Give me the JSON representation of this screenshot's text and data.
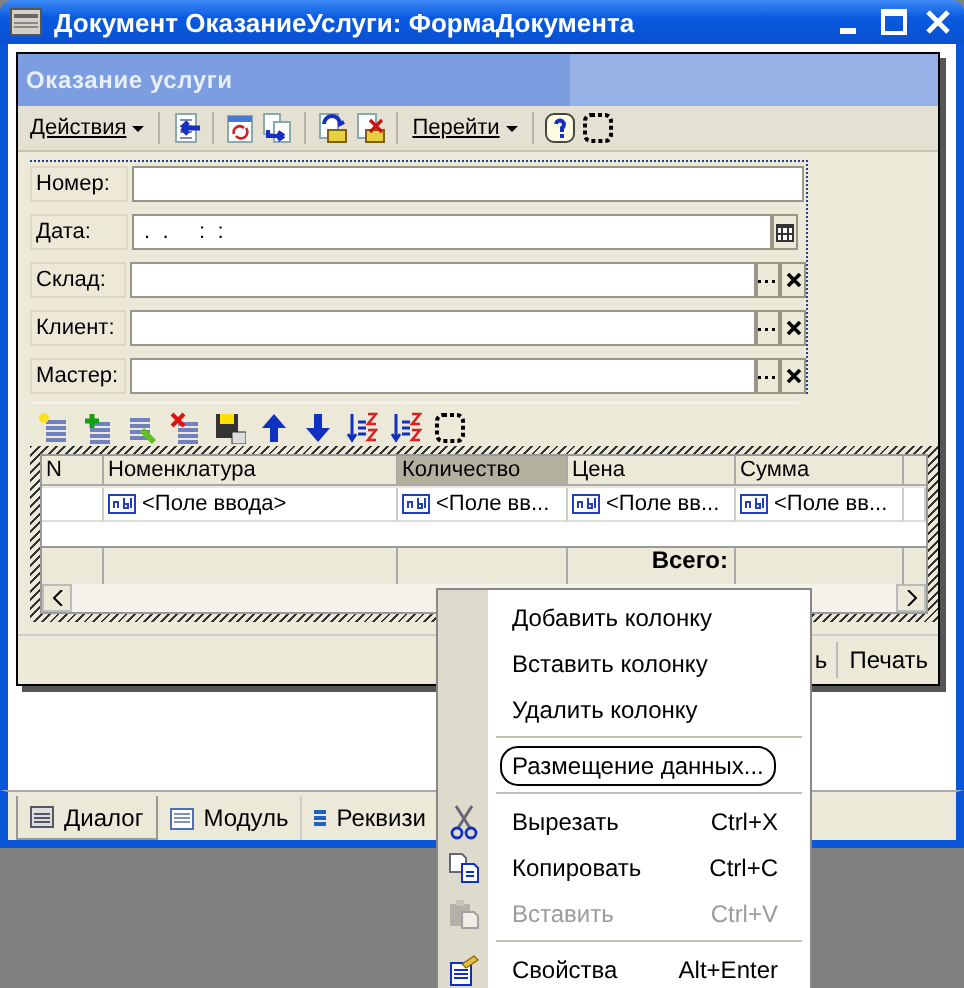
{
  "window": {
    "title": "Документ ОказаниеУслуги: ФормаДокумента"
  },
  "form": {
    "title": "Оказание услуги",
    "toolbar_menus": [
      "Действия",
      "Перейти"
    ],
    "fields": [
      {
        "kind": "text",
        "label": "Номер:"
      },
      {
        "kind": "date",
        "label": "Дата:",
        "value": " .  .     :  :"
      },
      {
        "kind": "ref",
        "label": "Склад:"
      },
      {
        "kind": "ref",
        "label": "Клиент:"
      },
      {
        "kind": "ref",
        "label": "Мастер:"
      }
    ],
    "table": {
      "columns": [
        {
          "label": "N",
          "selected": false
        },
        {
          "label": "Номенклатура",
          "selected": false
        },
        {
          "label": "Количество",
          "selected": true
        },
        {
          "label": "Цена",
          "selected": false
        },
        {
          "label": "Сумма",
          "selected": false
        }
      ],
      "rows": [
        {
          "cells": [
            "",
            "<Поле ввода>",
            "<Поле вв...",
            "<Поле вв...",
            "<Поле вв..."
          ]
        }
      ],
      "total_label": "Всего:"
    },
    "buttons": [
      "ь",
      "Печать"
    ]
  },
  "bottom_tabs": [
    {
      "label": "Диалог",
      "selected": true
    },
    {
      "label": "Модуль",
      "selected": false
    },
    {
      "label": "Реквизи",
      "selected": false
    }
  ],
  "context_menu": [
    {
      "kind": "item",
      "label": "Добавить колонку"
    },
    {
      "kind": "item",
      "label": "Вставить колонку"
    },
    {
      "kind": "item",
      "label": "Удалить колонку"
    },
    {
      "kind": "separator"
    },
    {
      "kind": "item",
      "label": "Размещение данных...",
      "focused": true
    },
    {
      "kind": "separator"
    },
    {
      "kind": "item",
      "label": "Вырезать",
      "shortcut": "Ctrl+X"
    },
    {
      "kind": "item",
      "label": "Копировать",
      "shortcut": "Ctrl+C"
    },
    {
      "kind": "item",
      "label": "Вставить",
      "shortcut": "Ctrl+V",
      "disabled": true
    },
    {
      "kind": "separator"
    },
    {
      "kind": "item",
      "label": "Свойства",
      "shortcut": "Alt+Enter"
    }
  ]
}
